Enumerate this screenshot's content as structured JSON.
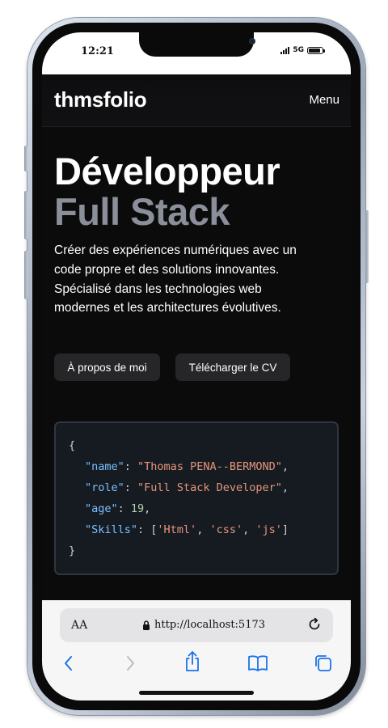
{
  "status_bar": {
    "time": "12:21",
    "network": "5G",
    "battery_level": 0.9,
    "signal_bars": 4
  },
  "nav": {
    "brand": "thmsfolio",
    "menu_label": "Menu"
  },
  "hero": {
    "title_line1": "Développeur",
    "title_line2": "Full Stack",
    "description": "Créer des expériences numériques avec un code propre et des solutions innovantes. Spécialisé dans les technologies web modernes et les architectures évolutives.",
    "buttons": {
      "about": "À propos de moi",
      "download_cv": "Télécharger le CV"
    }
  },
  "code_card": {
    "open": "{",
    "name_key": "\"name\"",
    "name_value": "\"Thomas PENA--BERMOND\"",
    "role_key": "\"role\"",
    "role_value": "\"Full Stack Developer\"",
    "age_key": "\"age\"",
    "age_value": "19",
    "skills_key": "\"Skills\"",
    "skills_values": [
      "'Html'",
      "'css'",
      "'js'"
    ],
    "close": "}"
  },
  "browser": {
    "text_size_button": "AA",
    "url": "http://localhost:5173",
    "icons": {
      "lock": "lock-icon",
      "reload": "reload-icon",
      "back": "chevron-left-icon",
      "forward": "chevron-right-icon",
      "share": "share-icon",
      "bookmarks": "book-icon",
      "tabs": "tabs-icon"
    },
    "accent_color": "#1a73e8"
  },
  "colors": {
    "page_background": "#0b0b0c",
    "title_secondary": "#8a8f99",
    "code_key": "#79c0ff",
    "code_string": "#e8957a",
    "code_number": "#b5cea8"
  }
}
